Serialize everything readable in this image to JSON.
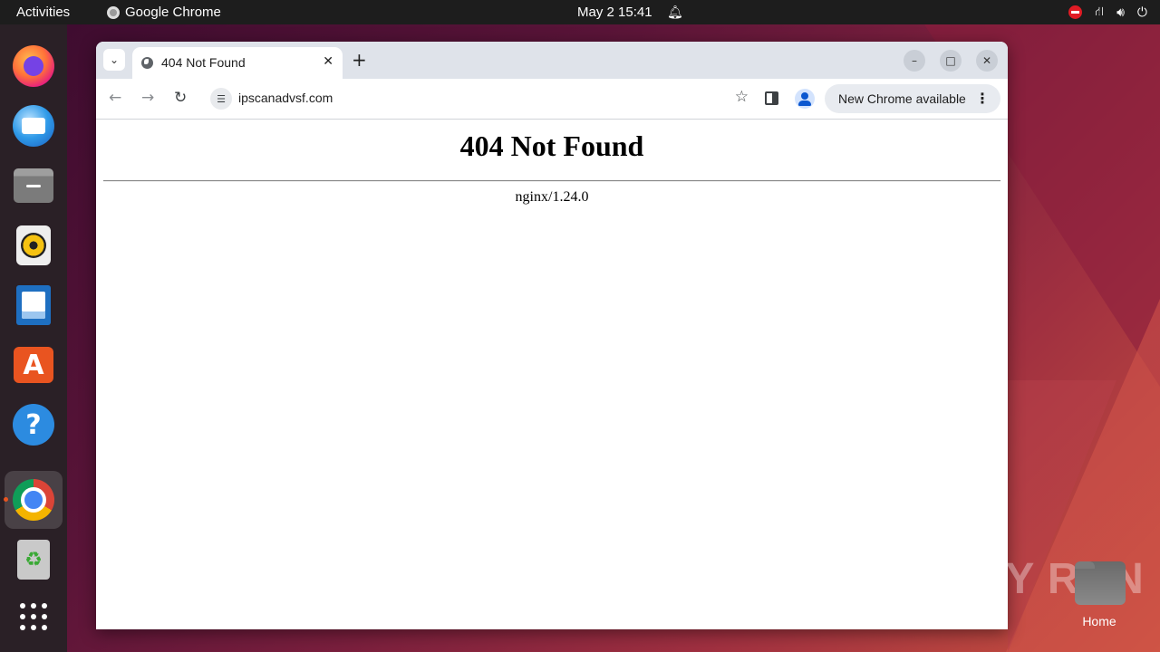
{
  "topbar": {
    "activities": "Activities",
    "app_name": "Google Chrome",
    "clock": "May 2  15:41"
  },
  "dock": {
    "items": [
      {
        "name": "firefox",
        "icon": "firefox-icon"
      },
      {
        "name": "thunderbird",
        "icon": "thunderbird-icon"
      },
      {
        "name": "files",
        "icon": "files-icon"
      },
      {
        "name": "rhythmbox",
        "icon": "rhythmbox-icon"
      },
      {
        "name": "libreoffice-writer",
        "icon": "writer-icon"
      },
      {
        "name": "app-center",
        "icon": "app-store-icon"
      },
      {
        "name": "help",
        "icon": "help-icon"
      },
      {
        "name": "google-chrome",
        "icon": "chrome-icon",
        "active": true
      },
      {
        "name": "trash",
        "icon": "trash-icon"
      },
      {
        "name": "show-apps",
        "icon": "app-grid-icon"
      }
    ]
  },
  "browser": {
    "tab": {
      "title": "404 Not Found",
      "close": "✕"
    },
    "new_tab": "+",
    "url": "ipscanadvsf.com",
    "update_button": "New Chrome available",
    "window_controls": {
      "minimize": "–",
      "maximize": "□",
      "close": "✕"
    }
  },
  "page": {
    "heading": "404 Not Found",
    "server": "nginx/1.24.0"
  },
  "desktop": {
    "home_label": "Home",
    "watermark": "ANY RUN"
  },
  "colors": {
    "topbar": "#1d1d1d",
    "dock": "#2a2026",
    "tabstrip": "#dfe3ea",
    "accent": "#e95420"
  }
}
